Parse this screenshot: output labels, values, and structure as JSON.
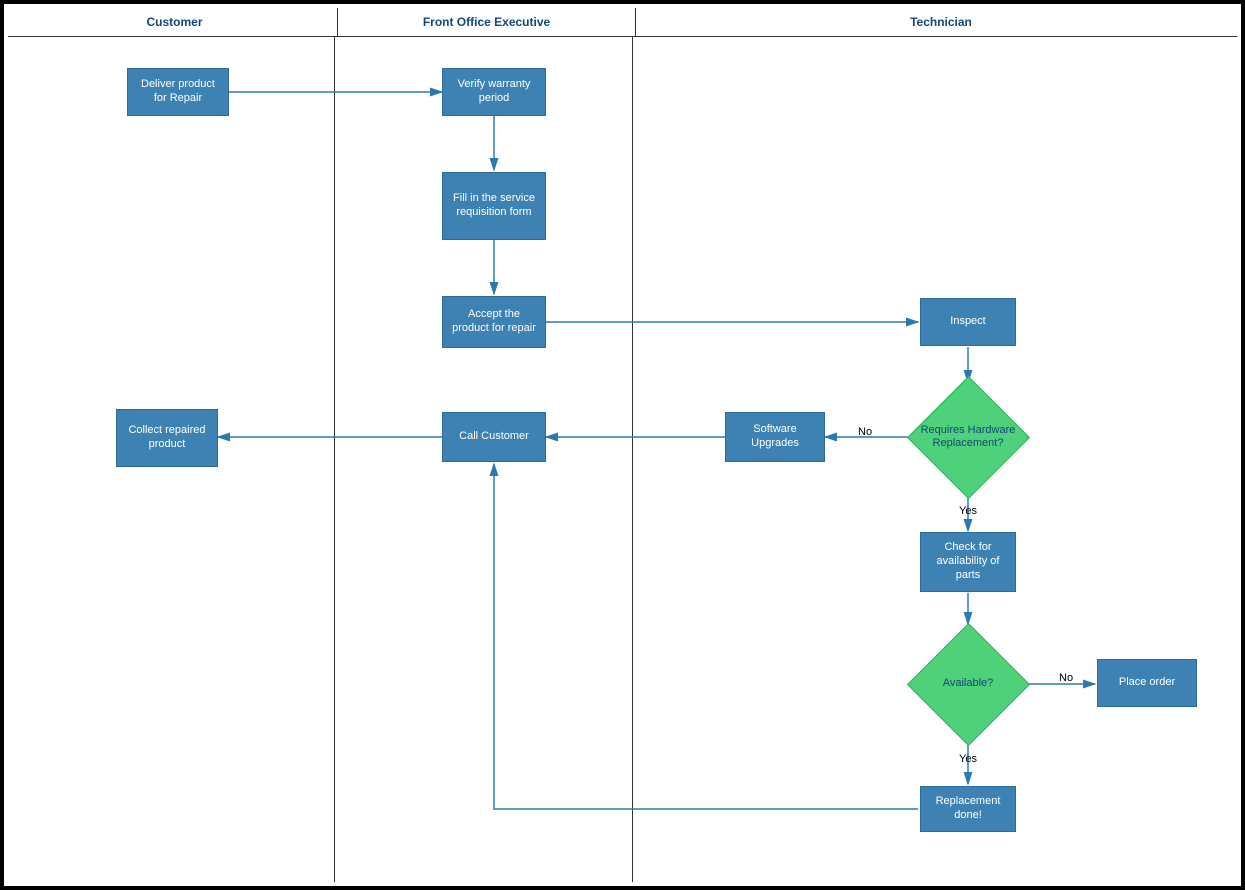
{
  "lanes": [
    {
      "name": "Customer"
    },
    {
      "name": "Front Office Executive"
    },
    {
      "name": "Technician"
    }
  ],
  "boxes": {
    "deliver": "Deliver product for Repair",
    "verify": "Verify warranty period",
    "fill": "Fill in the service requisition form",
    "accept": "Accept the product for repair",
    "inspect": "Inspect",
    "software": "Software Upgrades",
    "call": "Call Customer",
    "collect": "Collect repaired product",
    "checkparts": "Check for availability of parts",
    "placeorder": "Place order",
    "replacement": "Replacement done!"
  },
  "decisions": {
    "hardware": "Requires Hardware Replacement?",
    "available": "Available?"
  },
  "labels": {
    "yes": "Yes",
    "no": "No"
  },
  "colors": {
    "box_fill": "#3e82b3",
    "diamond_fill": "#4fd07a",
    "connector": "#2a7ab0"
  }
}
